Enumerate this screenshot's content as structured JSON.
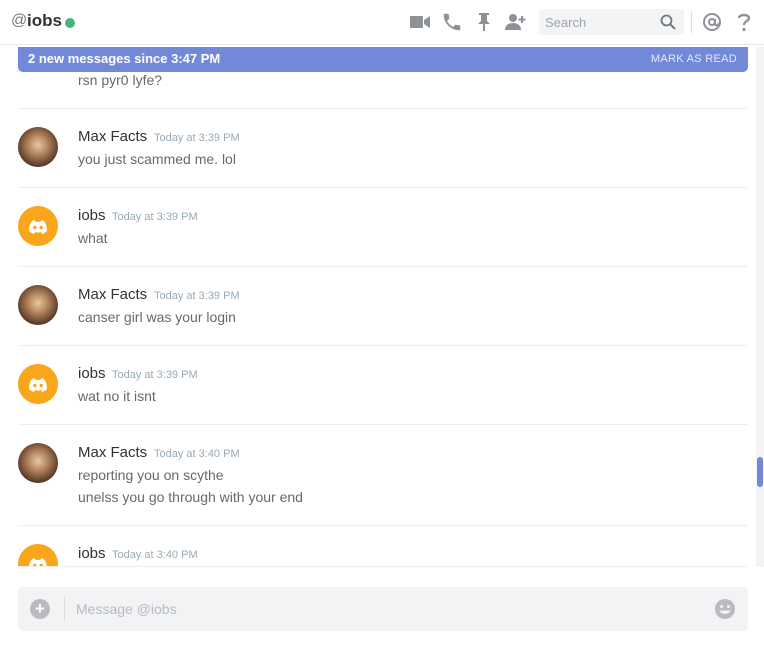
{
  "header": {
    "at_symbol": "@",
    "channel_name": "iobs",
    "status_color": "#43b581",
    "icons": [
      "video-call-icon",
      "voice-call-icon",
      "pin-icon",
      "add-friend-icon",
      "mention-icon",
      "help-icon"
    ],
    "search_placeholder": "Search"
  },
  "banner": {
    "text": "2 new messages since 3:47 PM",
    "action": "MARK AS READ",
    "color": "#7289da"
  },
  "messages": {
    "partial_line": "rsn pyr0 lyfe?",
    "items": [
      {
        "author": "Max Facts",
        "timestamp": "Today at 3:39 PM",
        "avatar": "photo",
        "lines": [
          "you just scammed me. lol"
        ]
      },
      {
        "author": "iobs",
        "timestamp": "Today at 3:39 PM",
        "avatar": "discord",
        "lines": [
          "what"
        ]
      },
      {
        "author": "Max Facts",
        "timestamp": "Today at 3:39 PM",
        "avatar": "photo",
        "lines": [
          "canser girl was your login"
        ]
      },
      {
        "author": "iobs",
        "timestamp": "Today at 3:39 PM",
        "avatar": "discord",
        "lines": [
          "wat no it isnt"
        ]
      },
      {
        "author": "Max Facts",
        "timestamp": "Today at 3:40 PM",
        "avatar": "photo",
        "lines": [
          "reporting you on scythe",
          "unelss you go through with your end"
        ]
      },
      {
        "author": "iobs",
        "timestamp": "Today at 3:40 PM",
        "avatar": "discord",
        "lines": []
      }
    ]
  },
  "composer": {
    "placeholder": "Message @iobs"
  },
  "colors": {
    "accent": "#7289da",
    "discord_avatar": "#faa61a"
  }
}
